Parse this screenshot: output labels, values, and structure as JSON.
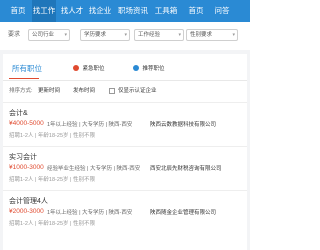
{
  "nav": {
    "items": [
      {
        "label": "首页"
      },
      {
        "label": "找工作"
      },
      {
        "label": "找人才"
      },
      {
        "label": "找企业"
      },
      {
        "label": "职场资讯"
      },
      {
        "label": "工具箱"
      },
      {
        "label": "首页"
      },
      {
        "label": "问答"
      }
    ],
    "active_index": 1,
    "colors": {
      "bar": "#2a8ad4",
      "active": "#1f76ba"
    }
  },
  "filters": {
    "items": [
      {
        "label": "要求",
        "value": "公司行业"
      },
      {
        "label": "",
        "value": "学历要求"
      },
      {
        "label": "",
        "value": "工作经验"
      },
      {
        "label": "",
        "value": "性别要求"
      }
    ]
  },
  "tabs": {
    "main": "所有职位",
    "pills": [
      {
        "label": "紧急职位",
        "icon": "fire-icon",
        "color": "#e04a2f"
      },
      {
        "label": "推荐职位",
        "icon": "star-icon",
        "color": "#2a8ad4"
      }
    ]
  },
  "sort": {
    "label": "排序方式:",
    "options": [
      "更新时间",
      "发布时间"
    ],
    "checkbox_label": "仅显示认证企业"
  },
  "jobs": [
    {
      "title": "会计&",
      "salary": "¥4000-5000",
      "meta": "1年以上经验 | 大专学历 | 陕西-西安",
      "meta2": "招聘1-2人 | 年龄18-25岁 | 性别不限",
      "company": "陕西云数教据科技有限公司",
      "company_meta": "",
      "apply": ""
    },
    {
      "title": "实习会计",
      "salary": "¥1000-3000",
      "meta": "经验毕业生经验 | 大专学历 | 陕西-西安",
      "meta2": "招聘1-2人 | 年龄18-25岁 | 性别不限",
      "company": "西安北辰先财税咨询有限公司",
      "company_meta": "",
      "apply": ""
    },
    {
      "title": "会计管理4人",
      "salary": "¥2000-3000",
      "meta": "1年以上经验 | 大专学历 | 陕西-西安",
      "meta2": "招聘1-2人 | 年龄18-25岁 | 性别不限",
      "company": "陕西随金企业管理有限公司",
      "company_meta": "",
      "apply": ""
    }
  ]
}
